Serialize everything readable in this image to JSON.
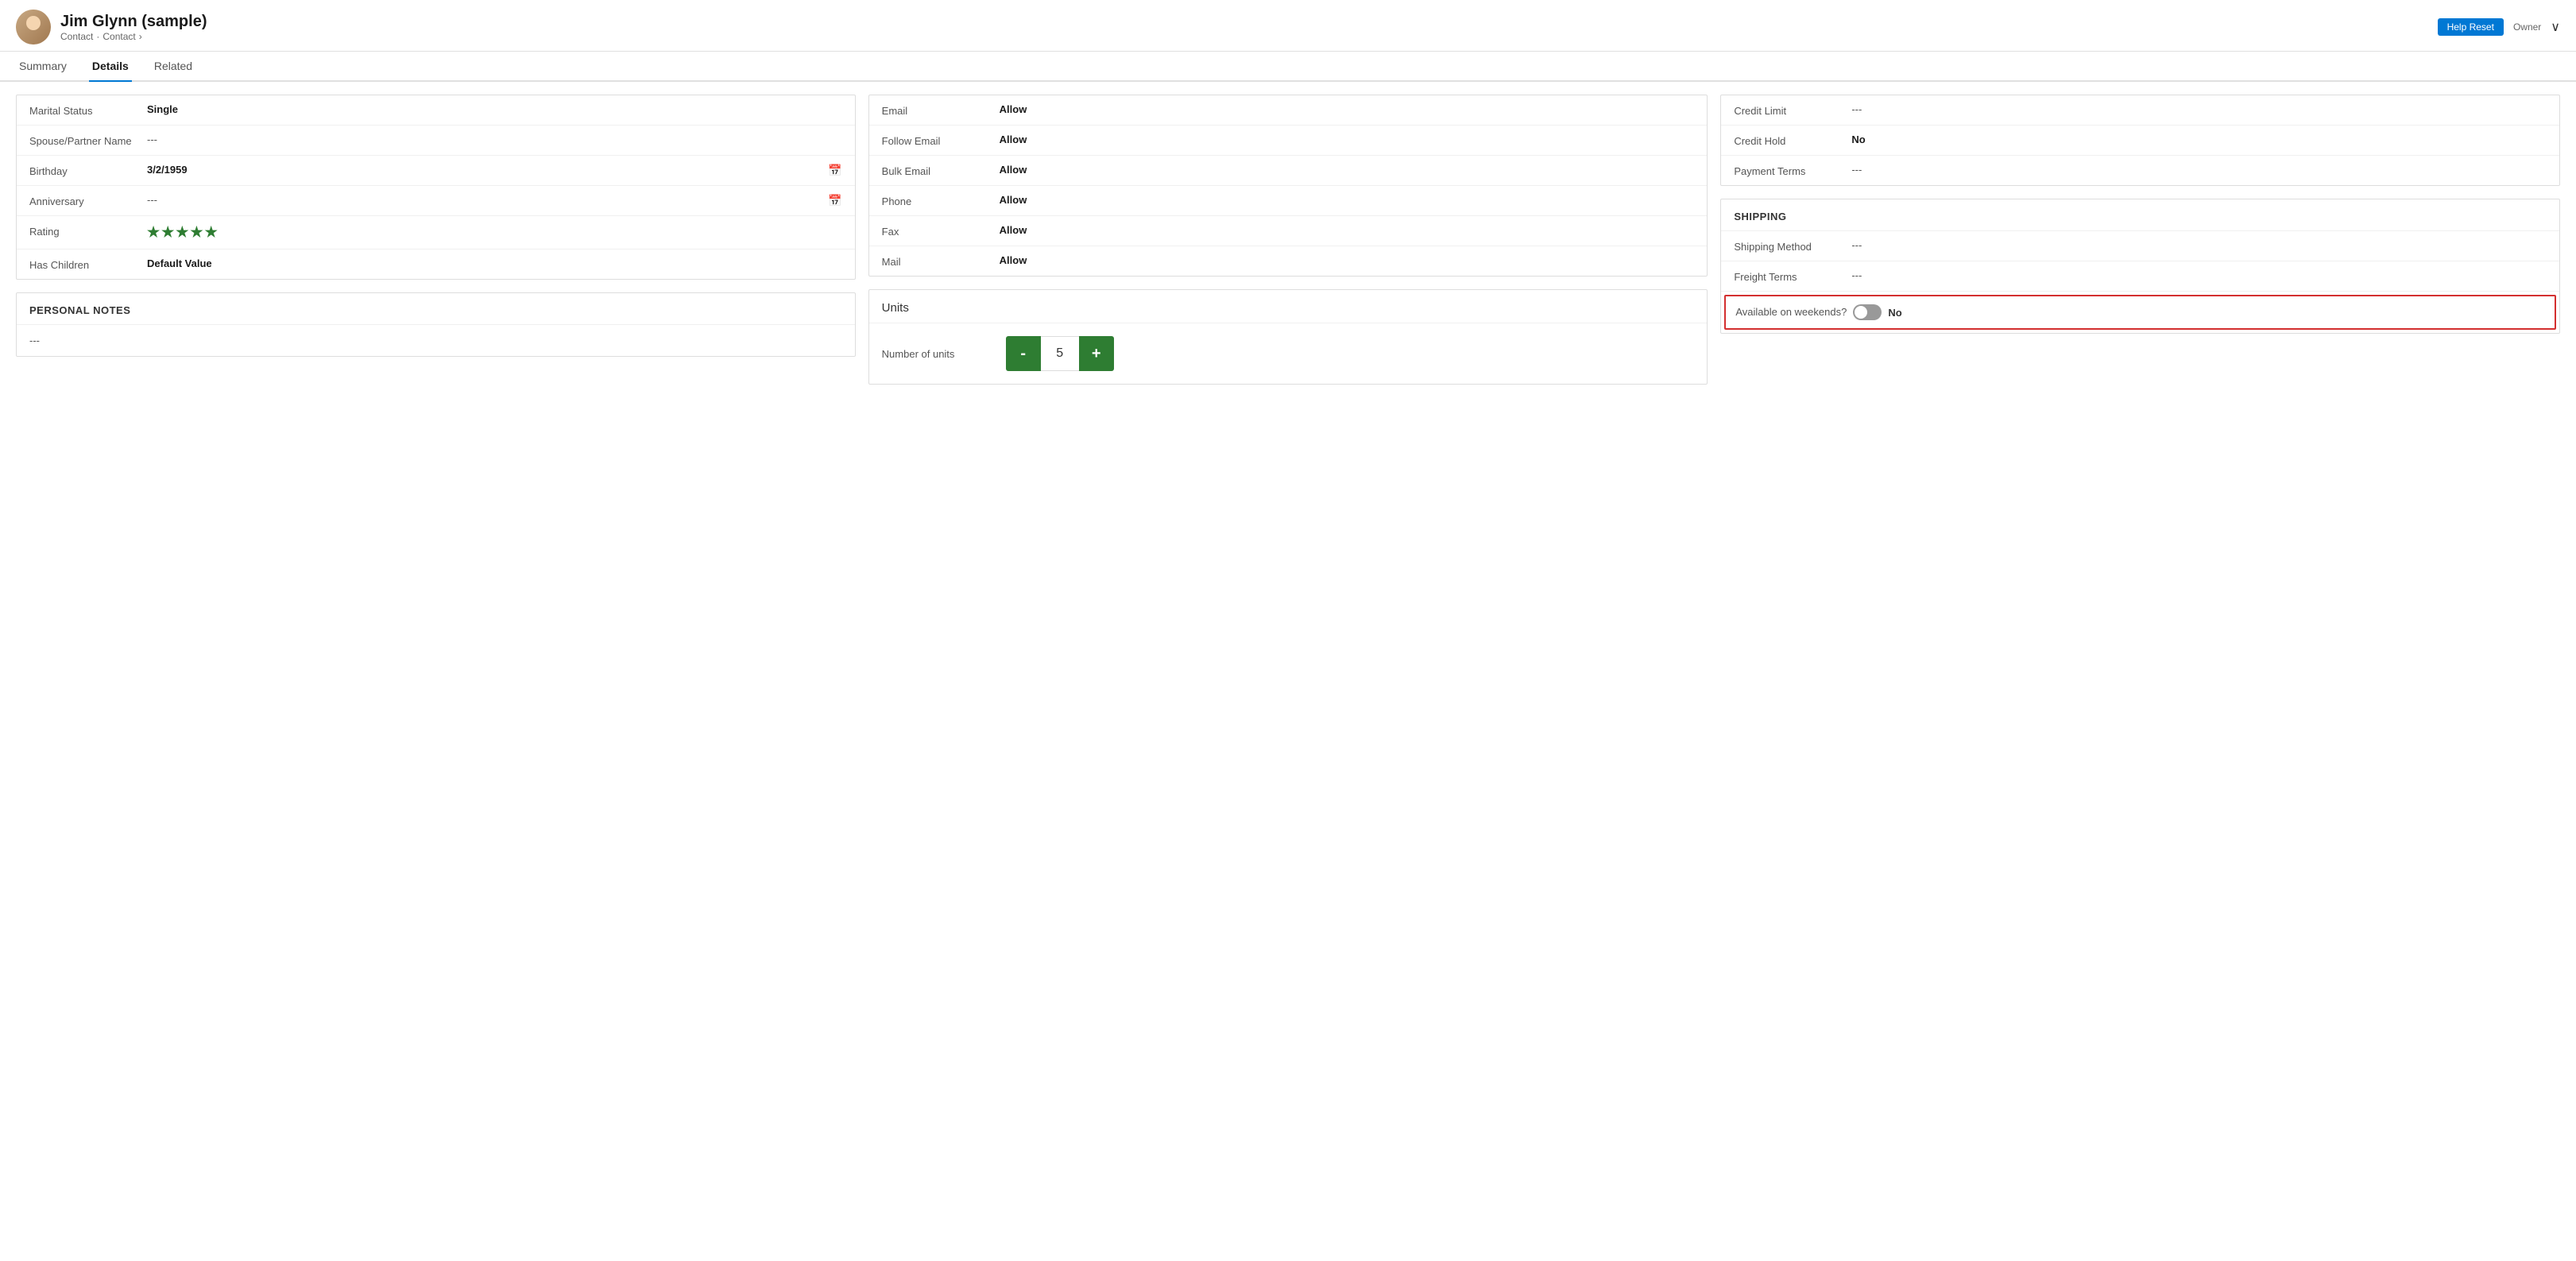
{
  "header": {
    "name": "Jim Glynn (sample)",
    "subtitle1": "Contact",
    "subtitle2": "Contact",
    "chevron": "›",
    "help_label": "Help Reset",
    "owner_label": "Owner",
    "chevron_down": "∨"
  },
  "tabs": [
    {
      "id": "summary",
      "label": "Summary",
      "active": false
    },
    {
      "id": "details",
      "label": "Details",
      "active": true
    },
    {
      "id": "related",
      "label": "Related",
      "active": false
    }
  ],
  "personal_info": {
    "section_title": "",
    "fields": [
      {
        "label": "Marital Status",
        "value": "Single",
        "empty": false,
        "type": "text"
      },
      {
        "label": "Spouse/Partner Name",
        "value": "---",
        "empty": true,
        "type": "text"
      },
      {
        "label": "Birthday",
        "value": "3/2/1959",
        "empty": false,
        "type": "date"
      },
      {
        "label": "Anniversary",
        "value": "---",
        "empty": true,
        "type": "date"
      },
      {
        "label": "Rating",
        "value": "★★★★★",
        "empty": false,
        "type": "stars",
        "count": 5
      },
      {
        "label": "Has Children",
        "value": "Default Value",
        "empty": false,
        "type": "text"
      }
    ]
  },
  "personal_notes": {
    "section_title": "PERSONAL NOTES",
    "content": "---"
  },
  "contact_preferences": {
    "fields": [
      {
        "label": "Email",
        "value": "Allow",
        "empty": false
      },
      {
        "label": "Follow Email",
        "value": "Allow",
        "empty": false
      },
      {
        "label": "Bulk Email",
        "value": "Allow",
        "empty": false
      },
      {
        "label": "Phone",
        "value": "Allow",
        "empty": false
      },
      {
        "label": "Fax",
        "value": "Allow",
        "empty": false
      },
      {
        "label": "Mail",
        "value": "Allow",
        "empty": false
      }
    ]
  },
  "units": {
    "section_title": "Units",
    "number_of_units_label": "Number of units",
    "value": 5,
    "minus_label": "-",
    "plus_label": "+"
  },
  "billing": {
    "fields": [
      {
        "label": "Credit Limit",
        "value": "---",
        "empty": true
      },
      {
        "label": "Credit Hold",
        "value": "No",
        "empty": false
      },
      {
        "label": "Payment Terms",
        "value": "---",
        "empty": true
      }
    ]
  },
  "shipping": {
    "section_title": "SHIPPING",
    "fields": [
      {
        "label": "Shipping Method",
        "value": "---",
        "empty": true
      },
      {
        "label": "Freight Terms",
        "value": "---",
        "empty": true
      }
    ],
    "weekend": {
      "label": "Available on weekends?",
      "toggle_value": false,
      "value_label": "No"
    }
  }
}
